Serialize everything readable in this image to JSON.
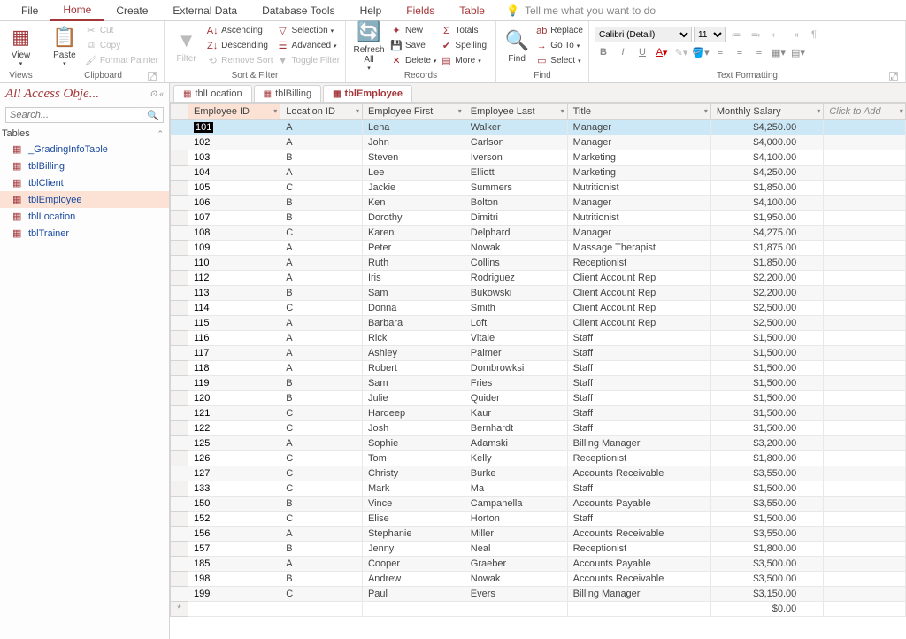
{
  "tabs": {
    "file": "File",
    "home": "Home",
    "create": "Create",
    "external": "External Data",
    "dbtools": "Database Tools",
    "help": "Help",
    "fields": "Fields",
    "table": "Table",
    "tellme": "Tell me what you want to do"
  },
  "ribbon": {
    "views": {
      "view": "View",
      "label": "Views"
    },
    "clipboard": {
      "paste": "Paste",
      "cut": "Cut",
      "copy": "Copy",
      "fmtpainter": "Format Painter",
      "label": "Clipboard"
    },
    "sort": {
      "filter": "Filter",
      "asc": "Ascending",
      "desc": "Descending",
      "remove": "Remove Sort",
      "selection": "Selection",
      "advanced": "Advanced",
      "toggle": "Toggle Filter",
      "label": "Sort & Filter"
    },
    "records": {
      "refresh": "Refresh\nAll",
      "new": "New",
      "save": "Save",
      "delete": "Delete",
      "totals": "Totals",
      "spelling": "Spelling",
      "more": "More",
      "label": "Records"
    },
    "find": {
      "find": "Find",
      "replace": "Replace",
      "goto": "Go To",
      "select": "Select",
      "label": "Find"
    },
    "fmt": {
      "font": "Calibri (Detail)",
      "size": "11",
      "label": "Text Formatting"
    }
  },
  "nav": {
    "title": "All Access Obje...",
    "search_ph": "Search...",
    "group": "Tables",
    "items": [
      "_GradingInfoTable",
      "tblBilling",
      "tblClient",
      "tblEmployee",
      "tblLocation",
      "tblTrainer"
    ],
    "selected": "tblEmployee"
  },
  "docTabs": [
    {
      "label": "tblLocation"
    },
    {
      "label": "tblBilling"
    },
    {
      "label": "tblEmployee",
      "active": true
    }
  ],
  "columns": [
    "Employee ID",
    "Location ID",
    "Employee First",
    "Employee Last",
    "Title",
    "Monthly Salary",
    "Click to Add"
  ],
  "rows": [
    {
      "id": "101",
      "loc": "A",
      "first": "Lena",
      "last": "Walker",
      "title": "Manager",
      "salary": "$4,250.00",
      "sel": true
    },
    {
      "id": "102",
      "loc": "A",
      "first": "John",
      "last": "Carlson",
      "title": "Manager",
      "salary": "$4,000.00"
    },
    {
      "id": "103",
      "loc": "B",
      "first": "Steven",
      "last": "Iverson",
      "title": "Marketing",
      "salary": "$4,100.00"
    },
    {
      "id": "104",
      "loc": "A",
      "first": "Lee",
      "last": "Elliott",
      "title": "Marketing",
      "salary": "$4,250.00"
    },
    {
      "id": "105",
      "loc": "C",
      "first": "Jackie",
      "last": "Summers",
      "title": "Nutritionist",
      "salary": "$1,850.00"
    },
    {
      "id": "106",
      "loc": "B",
      "first": "Ken",
      "last": "Bolton",
      "title": "Manager",
      "salary": "$4,100.00"
    },
    {
      "id": "107",
      "loc": "B",
      "first": "Dorothy",
      "last": "Dimitri",
      "title": "Nutritionist",
      "salary": "$1,950.00"
    },
    {
      "id": "108",
      "loc": "C",
      "first": "Karen",
      "last": "Delphard",
      "title": "Manager",
      "salary": "$4,275.00"
    },
    {
      "id": "109",
      "loc": "A",
      "first": "Peter",
      "last": "Nowak",
      "title": "Massage Therapist",
      "salary": "$1,875.00"
    },
    {
      "id": "110",
      "loc": "A",
      "first": "Ruth",
      "last": "Collins",
      "title": "Receptionist",
      "salary": "$1,850.00"
    },
    {
      "id": "112",
      "loc": "A",
      "first": "Iris",
      "last": "Rodriguez",
      "title": "Client Account Rep",
      "salary": "$2,200.00"
    },
    {
      "id": "113",
      "loc": "B",
      "first": "Sam",
      "last": "Bukowski",
      "title": "Client Account Rep",
      "salary": "$2,200.00"
    },
    {
      "id": "114",
      "loc": "C",
      "first": "Donna",
      "last": "Smith",
      "title": "Client Account Rep",
      "salary": "$2,500.00"
    },
    {
      "id": "115",
      "loc": "A",
      "first": "Barbara",
      "last": "Loft",
      "title": "Client Account Rep",
      "salary": "$2,500.00"
    },
    {
      "id": "116",
      "loc": "A",
      "first": "Rick",
      "last": "Vitale",
      "title": "Staff",
      "salary": "$1,500.00"
    },
    {
      "id": "117",
      "loc": "A",
      "first": "Ashley",
      "last": "Palmer",
      "title": "Staff",
      "salary": "$1,500.00"
    },
    {
      "id": "118",
      "loc": "A",
      "first": "Robert",
      "last": "Dombrowksi",
      "title": "Staff",
      "salary": "$1,500.00"
    },
    {
      "id": "119",
      "loc": "B",
      "first": "Sam",
      "last": "Fries",
      "title": "Staff",
      "salary": "$1,500.00"
    },
    {
      "id": "120",
      "loc": "B",
      "first": "Julie",
      "last": "Quider",
      "title": "Staff",
      "salary": "$1,500.00"
    },
    {
      "id": "121",
      "loc": "C",
      "first": "Hardeep",
      "last": "Kaur",
      "title": "Staff",
      "salary": "$1,500.00"
    },
    {
      "id": "122",
      "loc": "C",
      "first": "Josh",
      "last": "Bernhardt",
      "title": "Staff",
      "salary": "$1,500.00"
    },
    {
      "id": "125",
      "loc": "A",
      "first": "Sophie",
      "last": "Adamski",
      "title": "Billing Manager",
      "salary": "$3,200.00"
    },
    {
      "id": "126",
      "loc": "C",
      "first": "Tom",
      "last": "Kelly",
      "title": "Receptionist",
      "salary": "$1,800.00"
    },
    {
      "id": "127",
      "loc": "C",
      "first": "Christy",
      "last": "Burke",
      "title": "Accounts Receivable",
      "salary": "$3,550.00"
    },
    {
      "id": "133",
      "loc": "C",
      "first": "Mark",
      "last": "Ma",
      "title": "Staff",
      "salary": "$1,500.00"
    },
    {
      "id": "150",
      "loc": "B",
      "first": "Vince",
      "last": "Campanella",
      "title": "Accounts Payable",
      "salary": "$3,550.00"
    },
    {
      "id": "152",
      "loc": "C",
      "first": "Elise",
      "last": "Horton",
      "title": "Staff",
      "salary": "$1,500.00"
    },
    {
      "id": "156",
      "loc": "A",
      "first": "Stephanie",
      "last": "Miller",
      "title": "Accounts Receivable",
      "salary": "$3,550.00"
    },
    {
      "id": "157",
      "loc": "B",
      "first": "Jenny",
      "last": "Neal",
      "title": "Receptionist",
      "salary": "$1,800.00"
    },
    {
      "id": "185",
      "loc": "A",
      "first": "Cooper",
      "last": "Graeber",
      "title": "Accounts Payable",
      "salary": "$3,500.00"
    },
    {
      "id": "198",
      "loc": "B",
      "first": "Andrew",
      "last": "Nowak",
      "title": "Accounts Receivable",
      "salary": "$3,500.00"
    },
    {
      "id": "199",
      "loc": "C",
      "first": "Paul",
      "last": "Evers",
      "title": "Billing Manager",
      "salary": "$3,150.00"
    }
  ],
  "newrow_salary": "$0.00"
}
